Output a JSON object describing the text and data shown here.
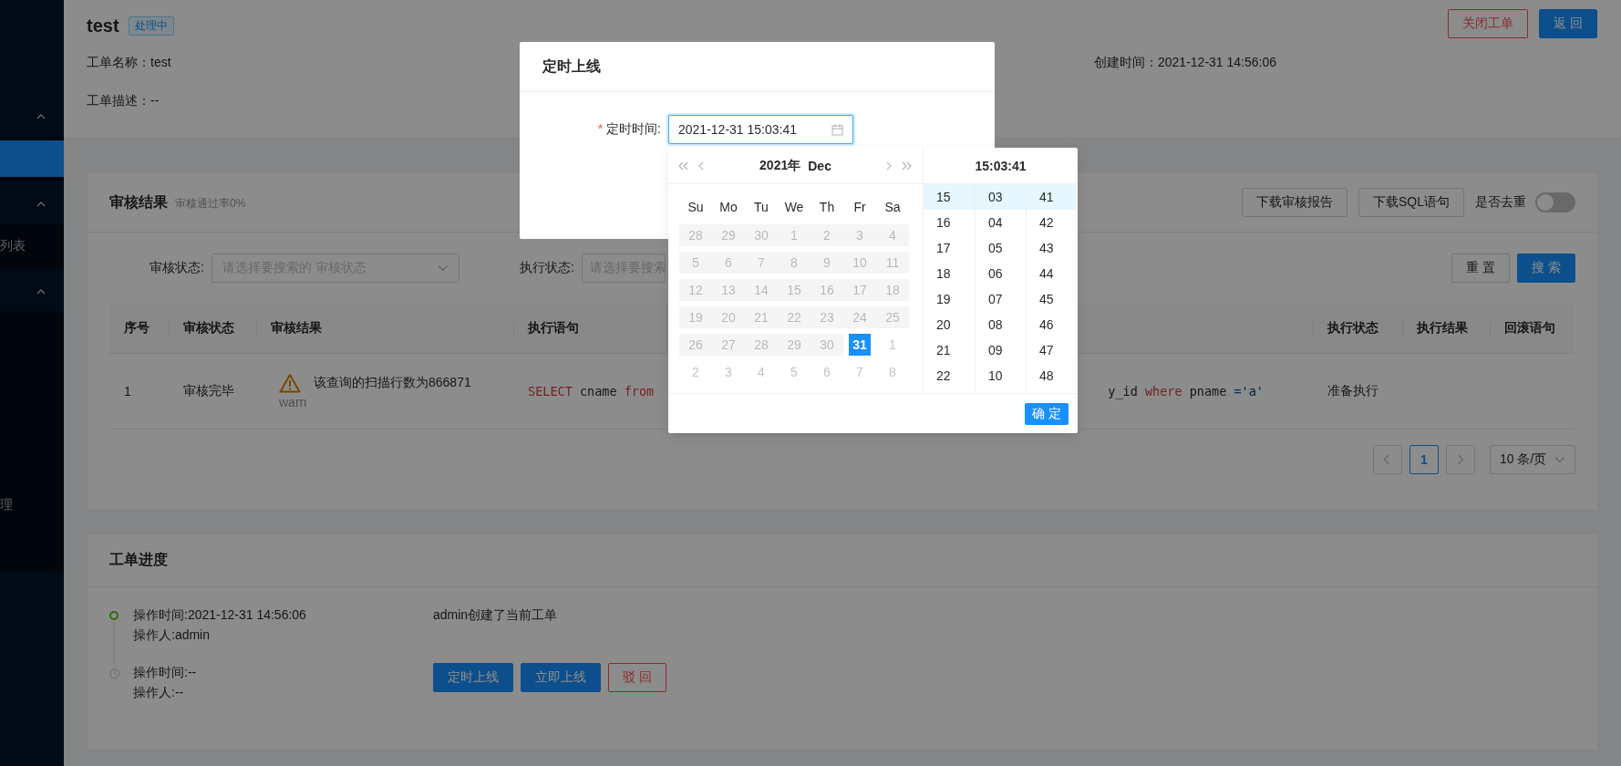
{
  "sidebar": {
    "menus": [
      {
        "expanded": true,
        "children": [
          {
            "selected": true
          }
        ]
      },
      {
        "expanded": true,
        "children": [
          {
            "label": "列表",
            "selected": false
          }
        ]
      },
      {
        "expanded": true,
        "children": [
          {
            "label": "理",
            "selected": false
          }
        ]
      }
    ]
  },
  "header": {
    "title": "test",
    "status_tag": "处理中",
    "buttons": [
      {
        "label": "关闭工单",
        "kind": "danger"
      },
      {
        "label": "返 回",
        "kind": "primary"
      }
    ],
    "info_rows": [
      [
        "工单名称：test",
        "创建时间：2021-12-31 14:56:06"
      ],
      [
        "工单描述：--"
      ]
    ]
  },
  "audit": {
    "title": "审核结果",
    "subtitle": "审核通过率0%",
    "buttons": [
      "下载审核报告",
      "下载SQL语句"
    ],
    "dedupe": {
      "label": "是否去重",
      "on": false
    },
    "filters": [
      {
        "label": "审核状态:",
        "placeholder": "请选择要搜索的 审核状态"
      },
      {
        "label": "执行状态:",
        "placeholder": "请选择要搜索"
      }
    ],
    "actions": [
      {
        "label": "重 置",
        "kind": "default"
      },
      {
        "label": "搜 索",
        "kind": "primary"
      }
    ],
    "table": {
      "columns": [
        "序号",
        "审核状态",
        "审核结果",
        "执行语句",
        "执行状态",
        "执行结果",
        "回滚语句"
      ],
      "rows": [
        {
          "index": "1",
          "audit_status": "审核完毕",
          "result": {
            "kind": "warn",
            "message": "该查询的扫描行数为866871",
            "tag": "warn"
          },
          "sql_start": [
            {
              "text": "SELECT",
              "kind": "keyword"
            },
            {
              "text": " cname ",
              "kind": "plain"
            },
            {
              "text": "from",
              "kind": "keyword"
            }
          ],
          "sql_end": [
            {
              "text": "y_id ",
              "kind": "plain"
            },
            {
              "text": "where",
              "kind": "keyword"
            },
            {
              "text": " pname ",
              "kind": "plain"
            },
            {
              "text": "=",
              "kind": "operator"
            },
            {
              "text": "'a'",
              "kind": "string"
            }
          ],
          "exec_status": "准备执行"
        }
      ]
    },
    "pagination": {
      "pages": [
        {
          "label": "1",
          "selected": true
        }
      ],
      "page_size": "10 条/页"
    }
  },
  "progress": {
    "title": "工单进度",
    "steps": [
      {
        "kind": "done",
        "time": "操作时间:2021-12-31 14:56:06",
        "operator": "操作人:admin",
        "note": "admin创建了当前工单"
      },
      {
        "kind": "pending",
        "time": "操作时间:--",
        "operator": "操作人:--",
        "actions": [
          {
            "label": "定时上线",
            "kind": "primary"
          },
          {
            "label": "立即上线",
            "kind": "primary"
          },
          {
            "label": "驳 回",
            "kind": "danger"
          }
        ]
      }
    ]
  },
  "modal": {
    "title": "定时上线",
    "field": {
      "label": "定时时间:",
      "required_mark": "*",
      "value": "2021-12-31 15:03:41"
    },
    "picker": {
      "year": "2021年",
      "month": "Dec",
      "weekdays": [
        "Su",
        "Mo",
        "Tu",
        "We",
        "Th",
        "Fr",
        "Sa"
      ],
      "weeks": [
        [
          {
            "d": "28",
            "kind": "disabled",
            "selected": false
          },
          {
            "d": "29",
            "kind": "disabled",
            "selected": false
          },
          {
            "d": "30",
            "kind": "disabled",
            "selected": false
          },
          {
            "d": "1",
            "kind": "disabled",
            "selected": false
          },
          {
            "d": "2",
            "kind": "disabled",
            "selected": false
          },
          {
            "d": "3",
            "kind": "disabled",
            "selected": false
          },
          {
            "d": "4",
            "kind": "disabled",
            "selected": false
          }
        ],
        [
          {
            "d": "5",
            "kind": "disabled",
            "selected": false
          },
          {
            "d": "6",
            "kind": "disabled",
            "selected": false
          },
          {
            "d": "7",
            "kind": "disabled",
            "selected": false
          },
          {
            "d": "8",
            "kind": "disabled",
            "selected": false
          },
          {
            "d": "9",
            "kind": "disabled",
            "selected": false
          },
          {
            "d": "10",
            "kind": "disabled",
            "selected": false
          },
          {
            "d": "11",
            "kind": "disabled",
            "selected": false
          }
        ],
        [
          {
            "d": "12",
            "kind": "disabled",
            "selected": false
          },
          {
            "d": "13",
            "kind": "disabled",
            "selected": false
          },
          {
            "d": "14",
            "kind": "disabled",
            "selected": false
          },
          {
            "d": "15",
            "kind": "disabled",
            "selected": false
          },
          {
            "d": "16",
            "kind": "disabled",
            "selected": false
          },
          {
            "d": "17",
            "kind": "disabled",
            "selected": false
          },
          {
            "d": "18",
            "kind": "disabled",
            "selected": false
          }
        ],
        [
          {
            "d": "19",
            "kind": "disabled",
            "selected": false
          },
          {
            "d": "20",
            "kind": "disabled",
            "selected": false
          },
          {
            "d": "21",
            "kind": "disabled",
            "selected": false
          },
          {
            "d": "22",
            "kind": "disabled",
            "selected": false
          },
          {
            "d": "23",
            "kind": "disabled",
            "selected": false
          },
          {
            "d": "24",
            "kind": "disabled",
            "selected": false
          },
          {
            "d": "25",
            "kind": "disabled",
            "selected": false
          }
        ],
        [
          {
            "d": "26",
            "kind": "disabled",
            "selected": false
          },
          {
            "d": "27",
            "kind": "disabled",
            "selected": false
          },
          {
            "d": "28",
            "kind": "disabled",
            "selected": false
          },
          {
            "d": "29",
            "kind": "disabled",
            "selected": false
          },
          {
            "d": "30",
            "kind": "disabled",
            "selected": false
          },
          {
            "d": "31",
            "kind": "normal",
            "selected": true
          },
          {
            "d": "1",
            "kind": "other",
            "selected": false
          }
        ],
        [
          {
            "d": "2",
            "kind": "other",
            "selected": false
          },
          {
            "d": "3",
            "kind": "other",
            "selected": false
          },
          {
            "d": "4",
            "kind": "other",
            "selected": false
          },
          {
            "d": "5",
            "kind": "other",
            "selected": false
          },
          {
            "d": "6",
            "kind": "other",
            "selected": false
          },
          {
            "d": "7",
            "kind": "other",
            "selected": false
          },
          {
            "d": "8",
            "kind": "other",
            "selected": false
          }
        ]
      ],
      "time": "15:03:41",
      "hours": [
        {
          "label": "15",
          "selected": true
        },
        {
          "label": "16",
          "selected": false
        },
        {
          "label": "17",
          "selected": false
        },
        {
          "label": "18",
          "selected": false
        },
        {
          "label": "19",
          "selected": false
        },
        {
          "label": "20",
          "selected": false
        },
        {
          "label": "21",
          "selected": false
        },
        {
          "label": "22",
          "selected": false
        }
      ],
      "minutes": [
        {
          "label": "03",
          "selected": true
        },
        {
          "label": "04",
          "selected": false
        },
        {
          "label": "05",
          "selected": false
        },
        {
          "label": "06",
          "selected": false
        },
        {
          "label": "07",
          "selected": false
        },
        {
          "label": "08",
          "selected": false
        },
        {
          "label": "09",
          "selected": false
        },
        {
          "label": "10",
          "selected": false
        }
      ],
      "seconds": [
        {
          "label": "41",
          "selected": true
        },
        {
          "label": "42",
          "selected": false
        },
        {
          "label": "43",
          "selected": false
        },
        {
          "label": "44",
          "selected": false
        },
        {
          "label": "45",
          "selected": false
        },
        {
          "label": "46",
          "selected": false
        },
        {
          "label": "47",
          "selected": false
        },
        {
          "label": "48",
          "selected": false
        }
      ],
      "ok": "确 定"
    }
  }
}
